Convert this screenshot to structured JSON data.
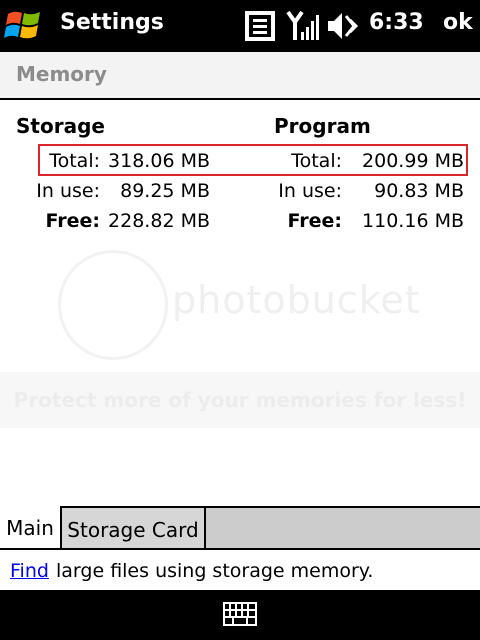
{
  "titlebar": {
    "title": "Settings",
    "time": "6:33",
    "ok_label": "ok",
    "icons": [
      "windows-start-icon",
      "notification-icon",
      "signal-icon",
      "volume-icon"
    ]
  },
  "page": {
    "title": "Memory"
  },
  "storage": {
    "heading": "Storage",
    "total_label": "Total:",
    "total_value": "318.06 MB",
    "inuse_label": "In use:",
    "inuse_value": "89.25 MB",
    "free_label": "Free:",
    "free_value": "228.82 MB"
  },
  "program": {
    "heading": "Program",
    "total_label": "Total:",
    "total_value": "200.99 MB",
    "inuse_label": "In use:",
    "inuse_value": "90.83 MB",
    "free_label": "Free:",
    "free_value": "110.16 MB"
  },
  "watermark": {
    "main": "photobucket",
    "sub": "Protect more of your memories for less!"
  },
  "tabs": [
    {
      "label": "Main",
      "active": true
    },
    {
      "label": "Storage Card",
      "active": false
    }
  ],
  "footer": {
    "link_text": "Find",
    "rest_text": "large files using storage memory."
  },
  "softbar": {
    "icon": "keyboard-icon"
  },
  "colors": {
    "highlight_border": "#d9262c",
    "title_gray": "#8c8c8c",
    "link": "#0000ee"
  }
}
